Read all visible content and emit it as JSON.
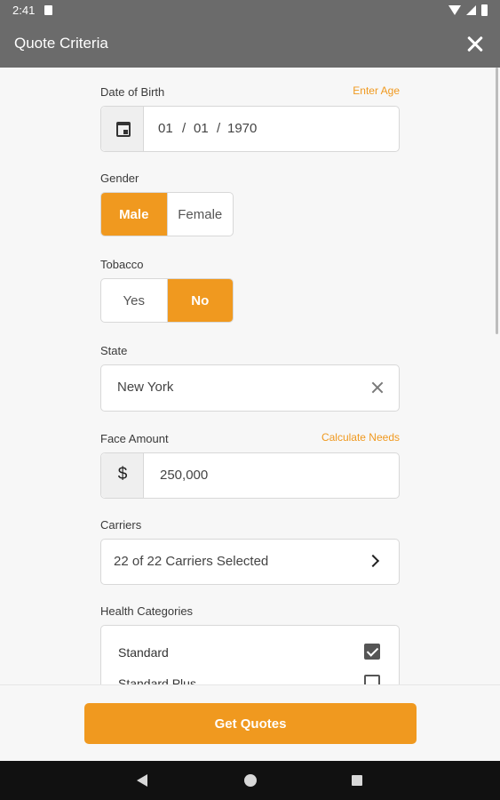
{
  "status": {
    "time": "2:41"
  },
  "appbar": {
    "title": "Quote Criteria"
  },
  "dob": {
    "label": "Date of Birth",
    "link": "Enter Age",
    "month": "01",
    "sep1": "/",
    "day": "01",
    "sep2": "/",
    "year": "1970"
  },
  "gender": {
    "label": "Gender",
    "options": [
      "Male",
      "Female"
    ],
    "selected": "Male"
  },
  "tobacco": {
    "label": "Tobacco",
    "options": [
      "Yes",
      "No"
    ],
    "selected": "No"
  },
  "state": {
    "label": "State",
    "value": "New York"
  },
  "face": {
    "label": "Face Amount",
    "link": "Calculate Needs",
    "prefix": "$",
    "value": "250,000"
  },
  "carriers": {
    "label": "Carriers",
    "value": "22 of 22 Carriers Selected"
  },
  "health": {
    "label": "Health Categories",
    "items": [
      {
        "label": "Standard",
        "checked": true
      },
      {
        "label": "Standard Plus",
        "checked": false
      }
    ]
  },
  "actions": {
    "get_quotes": "Get Quotes"
  },
  "colors": {
    "accent": "#f0991f",
    "appbar": "#6b6b6b"
  }
}
